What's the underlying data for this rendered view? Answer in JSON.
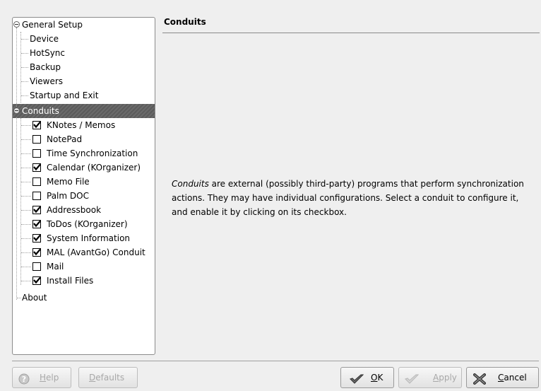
{
  "tree": {
    "general_setup": {
      "label": "General Setup",
      "children": [
        "Device",
        "HotSync",
        "Backup",
        "Viewers",
        "Startup and Exit"
      ]
    },
    "conduits": {
      "label": "Conduits",
      "items": [
        {
          "label": "KNotes / Memos",
          "checked": true
        },
        {
          "label": "NotePad",
          "checked": false
        },
        {
          "label": "Time Synchronization",
          "checked": false
        },
        {
          "label": "Calendar (KOrganizer)",
          "checked": true
        },
        {
          "label": "Memo File",
          "checked": false
        },
        {
          "label": "Palm DOC",
          "checked": false
        },
        {
          "label": "Addressbook",
          "checked": true
        },
        {
          "label": "ToDos (KOrganizer)",
          "checked": true
        },
        {
          "label": "System Information",
          "checked": true
        },
        {
          "label": "MAL (AvantGo) Conduit",
          "checked": true
        },
        {
          "label": "Mail",
          "checked": false
        },
        {
          "label": "Install Files",
          "checked": true
        }
      ]
    },
    "about": "About"
  },
  "content": {
    "title": "Conduits",
    "desc_em": "Conduits",
    "desc_rest": " are external (possibly third-party) programs that perform synchronization actions. They may have individual configurations. Select a conduit to configure it, and enable it by clicking on its checkbox."
  },
  "buttons": {
    "help": {
      "label": "Help",
      "mnemonic": "H"
    },
    "defaults": {
      "label": "Defaults",
      "mnemonic": "D"
    },
    "ok": {
      "label": "OK",
      "mnemonic": "O"
    },
    "apply": {
      "label": "Apply",
      "mnemonic": "A"
    },
    "cancel": {
      "label": "Cancel",
      "mnemonic": "C"
    }
  },
  "colors": {
    "selection": "#5f5f5f",
    "disabled_text": "#a8a8a8"
  }
}
